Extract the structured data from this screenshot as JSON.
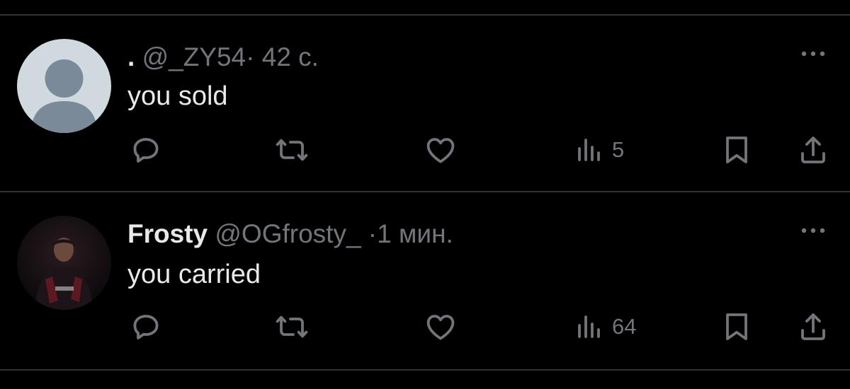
{
  "colors": {
    "background": "#000000",
    "text_primary": "#e7e9ea",
    "text_secondary": "#71767b",
    "divider": "#2f3336",
    "default_avatar_bg": "#cfd9de",
    "default_avatar_figure": "#7a8a99"
  },
  "tweets": [
    {
      "display_name": ".",
      "handle": "@_ZY54",
      "separator": "·",
      "time": "42 с.",
      "text": "you sold",
      "avatar": "default-profile-avatar",
      "views": "5",
      "icons": [
        "reply-icon",
        "retweet-icon",
        "like-icon",
        "views-icon",
        "bookmark-icon",
        "share-icon",
        "more-icon"
      ]
    },
    {
      "display_name": "Frosty",
      "handle": "@OGfrosty_",
      "separator": "·",
      "time": "1 мин.",
      "text": "you carried",
      "avatar": "profile-photo-avatar",
      "views": "64",
      "icons": [
        "reply-icon",
        "retweet-icon",
        "like-icon",
        "views-icon",
        "bookmark-icon",
        "share-icon",
        "more-icon"
      ]
    }
  ]
}
